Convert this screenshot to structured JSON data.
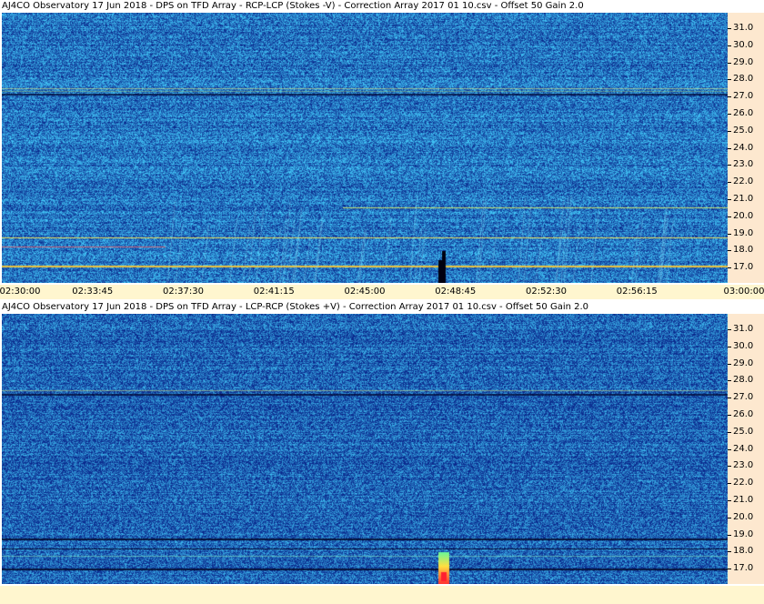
{
  "panels": [
    {
      "title": "AJ4CO Observatory 17 Jun 2018  -  DPS on TFD Array  -  RCP-LCP (Stokes -V)  -  Correction Array 2017 01 10.csv  -  Offset 50  Gain 2.0"
    },
    {
      "title": "AJ4CO Observatory 17 Jun 2018  -  DPS on TFD Array  -  LCP-RCP (Stokes +V)  -  Correction Array 2017 01 10.csv  -  Offset 50  Gain 2.0"
    }
  ],
  "frequency_ticks": [
    "31.0",
    "30.0",
    "29.0",
    "28.0",
    "27.0",
    "26.0",
    "25.0",
    "24.0",
    "23.0",
    "22.0",
    "21.0",
    "20.0",
    "19.0",
    "18.0",
    "17.0"
  ],
  "time_ticks": [
    "02:30:00",
    "02:33:45",
    "02:37:30",
    "02:41:15",
    "02:45:00",
    "02:48:45",
    "02:52:30",
    "02:56:15",
    "03:00:00"
  ],
  "colors": {
    "background_low": "#1a3fb0",
    "background_high": "#3fa0f0",
    "axis_bg": "#fde8cf",
    "time_axis_bg": "#fff6cf"
  }
}
